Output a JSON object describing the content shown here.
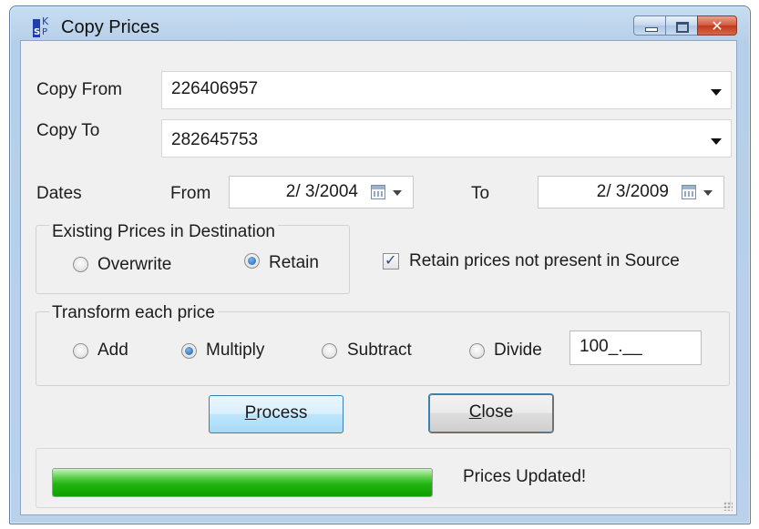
{
  "window": {
    "title": "Copy Prices",
    "icon": "ksp-app-icon"
  },
  "copy_from": {
    "label": "Copy From",
    "value": "226406957"
  },
  "copy_to": {
    "label": "Copy To",
    "value": "282645753"
  },
  "dates": {
    "label": "Dates",
    "from_label": "From",
    "from_value": "2/ 3/2004",
    "to_label": "To",
    "to_value": "2/ 3/2009"
  },
  "existing_prices": {
    "legend": "Existing Prices in Destination",
    "overwrite_label": "Overwrite",
    "retain_label": "Retain",
    "selected": "Retain"
  },
  "retain_not_present": {
    "label": "Retain prices not present in Source",
    "checked": true
  },
  "transform": {
    "legend": "Transform each price",
    "add_label": "Add",
    "multiply_label": "Multiply",
    "subtract_label": "Subtract",
    "divide_label": "Divide",
    "selected": "Multiply",
    "value": "100_.__"
  },
  "buttons": {
    "process_mnemonic": "P",
    "process_rest": "rocess",
    "close_mnemonic": "C",
    "close_rest": "lose"
  },
  "status": {
    "text": "Prices Updated!",
    "progress": 1.0
  },
  "colors": {
    "progress_green": "#22b512",
    "title_bar": "#b9d1ea",
    "close_red": "#c0391c"
  }
}
